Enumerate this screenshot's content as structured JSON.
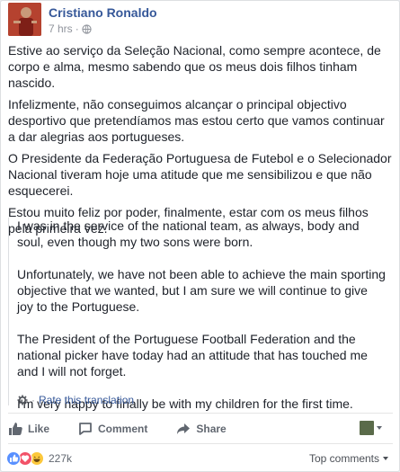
{
  "post": {
    "author": "Cristiano Ronaldo",
    "time": "7 hrs",
    "separator": "·",
    "body": [
      "Estive ao serviço da Seleção Nacional, como sempre acontece, de corpo e alma, mesmo sabendo que os meus dois filhos tinham nascido.",
      "Infelizmente, não conseguimos alcançar o principal objectivo desportivo que pretendíamos mas estou certo que vamos continuar a dar alegrias aos portugueses.",
      "O Presidente da Federação Portuguesa de Futebol e o Selecionador Nacional tiveram hoje uma atitude que me sensibilizou e que não esquecerei.",
      "Estou muito feliz por poder, finalmente, estar com os meus filhos pela primeira vez."
    ],
    "translation": [
      "I was in the service of the national team, as always, body and soul, even though my two sons were born.",
      "Unfortunately, we have not been able to achieve the main sporting objective that we wanted, but I am sure we will continue to give joy to the Portuguese.",
      "The President of the Portuguese Football Federation and the national picker have today had an attitude that has touched me and I will not forget.",
      "I'm very happy to finally be with my children for the first time."
    ],
    "rate_dot": "·",
    "rate_label": "Rate this translation"
  },
  "actions": {
    "like": "Like",
    "comment": "Comment",
    "share": "Share"
  },
  "footer": {
    "reaction_count": "227k",
    "sort_label": "Top comments"
  },
  "icons": {
    "globe": "globe-icon",
    "gear": "gear-icon",
    "like": "thumbs-up-icon",
    "comment": "comment-icon",
    "share": "share-arrow-icon"
  },
  "colors": {
    "link": "#365899",
    "secondary_text": "#90949c",
    "action_text": "#616770",
    "like_reaction": "#5890ff",
    "love_reaction": "#f25268",
    "haha_reaction": "#fcc83c"
  }
}
